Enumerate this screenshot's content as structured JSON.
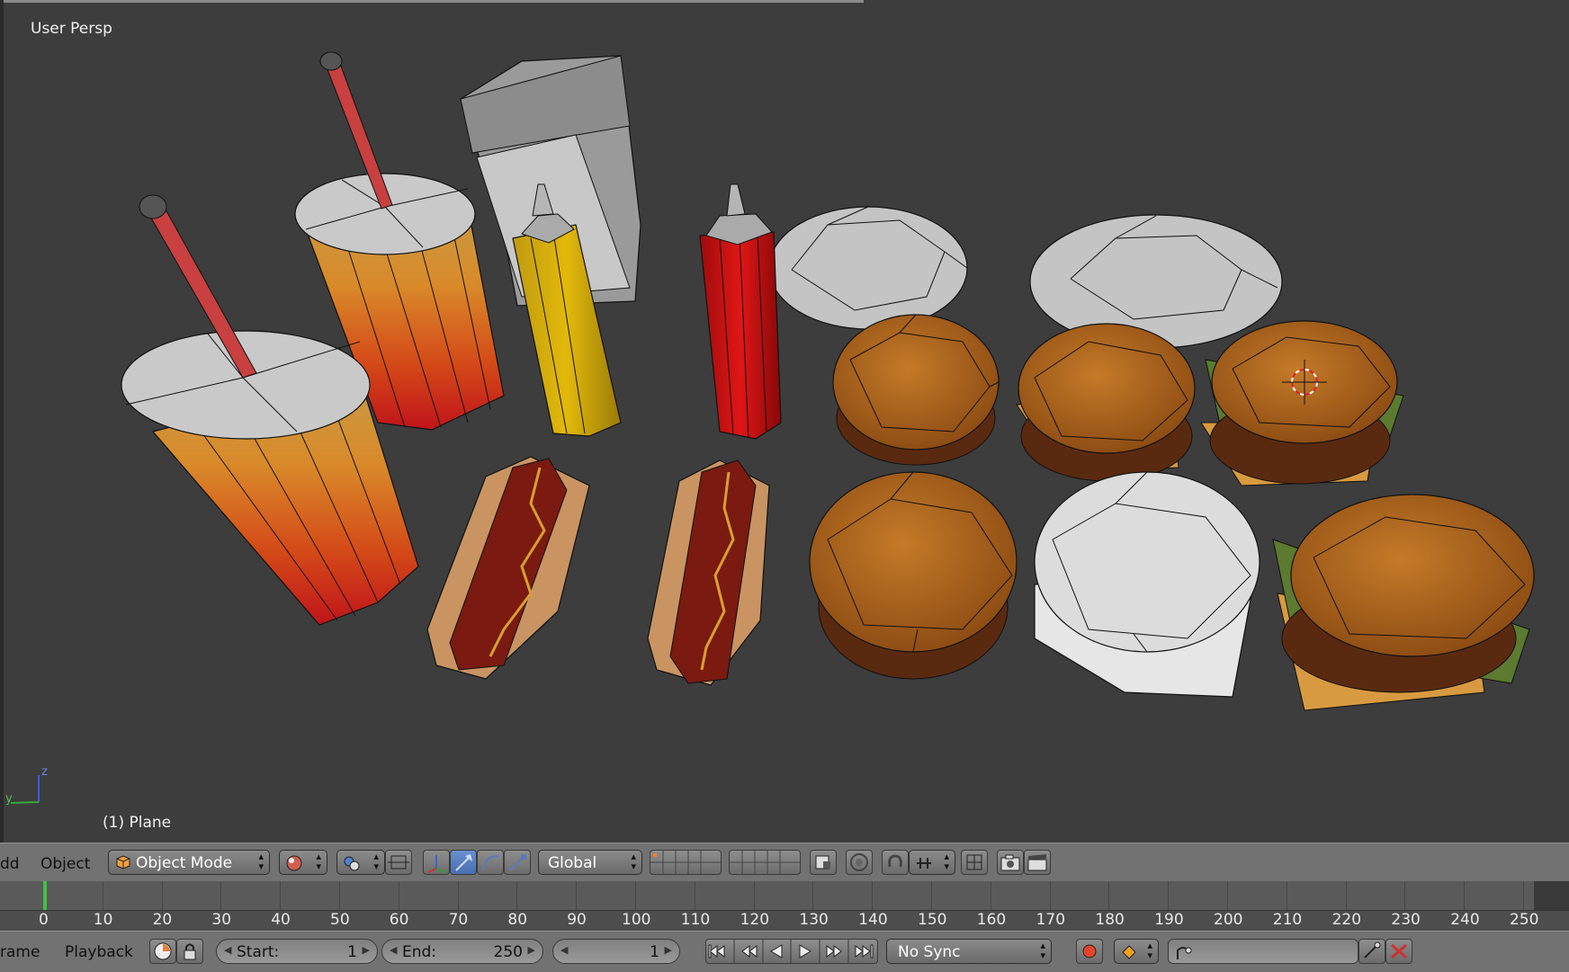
{
  "viewport": {
    "view_label": "User Persp",
    "object_label": "(1) Plane",
    "axis_z": "z",
    "axis_y": "y"
  },
  "header": {
    "menu_add": "dd",
    "menu_object": "Object",
    "mode": "Object Mode",
    "orientation": "Global"
  },
  "timeline": {
    "ticks": [
      "0",
      "10",
      "20",
      "30",
      "40",
      "50",
      "60",
      "70",
      "80",
      "90",
      "100",
      "110",
      "120",
      "130",
      "140",
      "150",
      "160",
      "170",
      "180",
      "190",
      "200",
      "210",
      "220",
      "230",
      "240",
      "250"
    ],
    "current_frame_marker": 1
  },
  "footer": {
    "menu_frame": "rame",
    "menu_playback": "Playback",
    "start_label": "Start:",
    "start_value": "1",
    "end_label": "End:",
    "end_value": "250",
    "current_frame": "1",
    "sync": "No Sync"
  },
  "colors": {
    "viewport_bg": "#3d3d3d",
    "header_bg": "#727272",
    "active_blue": "#5b80c4",
    "record_red": "#e0452a",
    "keyframe_orange": "#f0a020"
  }
}
